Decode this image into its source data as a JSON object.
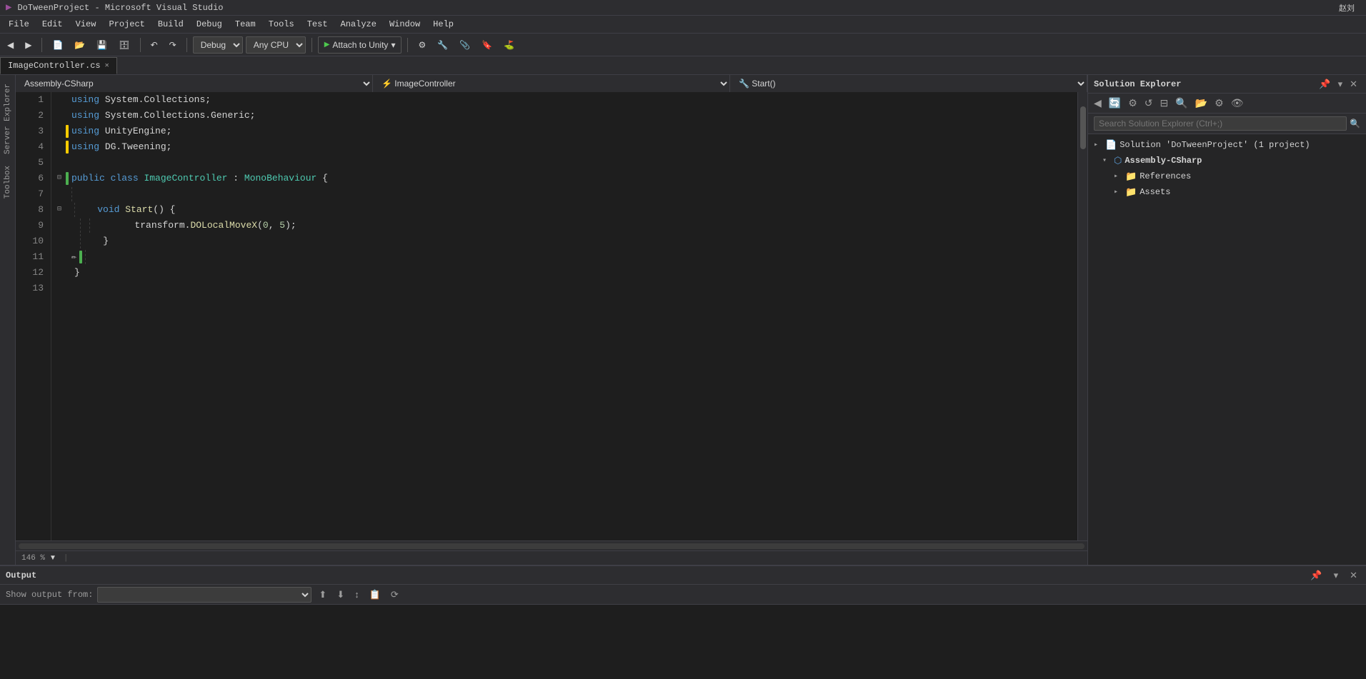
{
  "titlebar": {
    "logo": "▶",
    "title": "DoTweenProject - Microsoft Visual Studio"
  },
  "menubar": {
    "items": [
      "File",
      "Edit",
      "View",
      "Project",
      "Build",
      "Debug",
      "Team",
      "Tools",
      "Test",
      "Analyze",
      "Window",
      "Help"
    ]
  },
  "toolbar": {
    "debug_config": "Debug",
    "platform": "Any CPU",
    "attach_label": "Attach to Unity",
    "user": "赵刘",
    "signin_icon": "👤"
  },
  "tabs": [
    {
      "label": "ImageController.cs",
      "active": true
    },
    {
      "label": "×",
      "is_close": true
    }
  ],
  "editor_nav": {
    "namespace": "Assembly-CSharp",
    "class": "ImageController",
    "method": "Start()"
  },
  "code": {
    "lines": [
      {
        "num": 1,
        "indicator": "none",
        "content": "using System.Collections;",
        "tokens": [
          {
            "t": "kw",
            "v": "using"
          },
          {
            "t": "plain",
            "v": " System.Collections;"
          }
        ]
      },
      {
        "num": 2,
        "indicator": "none",
        "content": "using System.Collections.Generic;",
        "tokens": [
          {
            "t": "kw",
            "v": "using"
          },
          {
            "t": "plain",
            "v": " System.Collections.Generic;"
          }
        ]
      },
      {
        "num": 3,
        "indicator": "yellow",
        "content": "using UnityEngine;",
        "tokens": [
          {
            "t": "kw",
            "v": "using"
          },
          {
            "t": "plain",
            "v": " UnityEngine;"
          }
        ]
      },
      {
        "num": 4,
        "indicator": "yellow",
        "content": "using DG.Tweening;",
        "tokens": [
          {
            "t": "kw",
            "v": "using"
          },
          {
            "t": "plain",
            "v": " DG.Tweening;"
          }
        ]
      },
      {
        "num": 5,
        "indicator": "none",
        "content": ""
      },
      {
        "num": 6,
        "indicator": "green",
        "content": "public class ImageController : MonoBehaviour {",
        "tokens": [
          {
            "t": "kw",
            "v": "public"
          },
          {
            "t": "plain",
            "v": " "
          },
          {
            "t": "kw",
            "v": "class"
          },
          {
            "t": "plain",
            "v": " "
          },
          {
            "t": "type",
            "v": "ImageController"
          },
          {
            "t": "plain",
            "v": " : "
          },
          {
            "t": "type",
            "v": "MonoBehaviour"
          },
          {
            "t": "plain",
            "v": " {"
          }
        ]
      },
      {
        "num": 7,
        "indicator": "none",
        "content": ""
      },
      {
        "num": 8,
        "indicator": "none",
        "content": "    void Start() {",
        "tokens": [
          {
            "t": "plain",
            "v": "    "
          },
          {
            "t": "kw",
            "v": "void"
          },
          {
            "t": "plain",
            "v": " "
          },
          {
            "t": "method",
            "v": "Start"
          },
          {
            "t": "plain",
            "v": "() {"
          }
        ]
      },
      {
        "num": 9,
        "indicator": "none",
        "content": "        transform.DOLocalMoveX(0, 5);",
        "tokens": [
          {
            "t": "plain",
            "v": "        transform."
          },
          {
            "t": "method",
            "v": "DOLocalMoveX"
          },
          {
            "t": "plain",
            "v": "("
          },
          {
            "t": "num",
            "v": "0"
          },
          {
            "t": "plain",
            "v": ", "
          },
          {
            "t": "num",
            "v": "5"
          },
          {
            "t": "plain",
            "v": ");"
          }
        ]
      },
      {
        "num": 10,
        "indicator": "none",
        "content": "    }"
      },
      {
        "num": 11,
        "indicator": "pencil",
        "content": ""
      },
      {
        "num": 12,
        "indicator": "none",
        "content": "}"
      },
      {
        "num": 13,
        "indicator": "none",
        "content": ""
      }
    ]
  },
  "zoom": {
    "value": "146 %",
    "dropdown_icon": "▼"
  },
  "solution_explorer": {
    "title": "Solution Explorer",
    "search_placeholder": "Search Solution Explorer (Ctrl+;)",
    "tree": [
      {
        "level": 0,
        "icon": "📄",
        "label": "Solution 'DoTweenProject' (1 project)",
        "arrow": "▸",
        "expanded": false
      },
      {
        "level": 1,
        "icon": "🔷",
        "label": "Assembly-CSharp",
        "arrow": "▾",
        "expanded": true,
        "bold": true
      },
      {
        "level": 2,
        "icon": "📁",
        "label": "References",
        "arrow": "▸",
        "expanded": false
      },
      {
        "level": 2,
        "icon": "📁",
        "label": "Assets",
        "arrow": "▸",
        "expanded": false
      }
    ]
  },
  "output_panel": {
    "title": "Output",
    "show_label": "Show output from:",
    "source_dropdown": "",
    "toolbar_icons": [
      "⬆",
      "⬇",
      "⬆⬇",
      "📋",
      "🔄"
    ]
  }
}
